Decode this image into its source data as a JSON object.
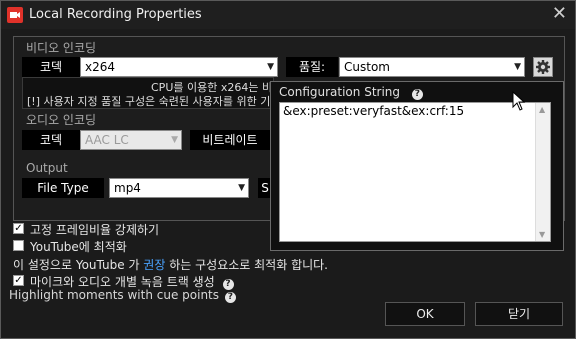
{
  "window": {
    "title": "Local Recording Properties",
    "close_glyph": "✕"
  },
  "video": {
    "section": "비디오 인코딩",
    "codec_label": "코덱",
    "codec_value": "x264",
    "quality_label": "품질:",
    "quality_value": "Custom",
    "info_line1": "CPU를 이용한 x264는 비",
    "info_line2": "[!] 사용자 지정 품질 구성은 숙련된 사용자를 위한 기"
  },
  "audio": {
    "section": "오디오 인코딩",
    "codec_label": "코덱",
    "codec_value": "AAC LC",
    "bitrate_label": "비트레이트"
  },
  "output": {
    "section": "Output",
    "filetype_label": "File Type",
    "filetype_value": "mp4",
    "partial_label": "S"
  },
  "config_popup": {
    "title": "Configuration String",
    "help_glyph": "?",
    "value": "&ex:preset:veryfast&ex:crf:15"
  },
  "options": {
    "fixed_framerate": {
      "label": "고정 프레임비율 강제하기",
      "checked": true
    },
    "youtube_optimize": {
      "label": "YouTube에 최적화",
      "checked": false
    },
    "youtube_note_before": "이 설정으로 YouTube 가 ",
    "youtube_note_link": "권장",
    "youtube_note_after": "하는 구성요소로 최적화 합니다.",
    "separate_tracks": {
      "label": "마이크와 오디오 개별 녹음 트랙 생성",
      "checked": true
    },
    "highlight_label": "Highlight moments with cue points"
  },
  "buttons": {
    "ok": "OK",
    "close": "닫기"
  },
  "glyphs": {
    "check": "✓",
    "dropdown": "▼",
    "scroll_up": "▲",
    "scroll_down": "▼",
    "help": "?"
  },
  "colors": {
    "link": "#4aa3ff",
    "accent_icon": "#e0322a"
  }
}
